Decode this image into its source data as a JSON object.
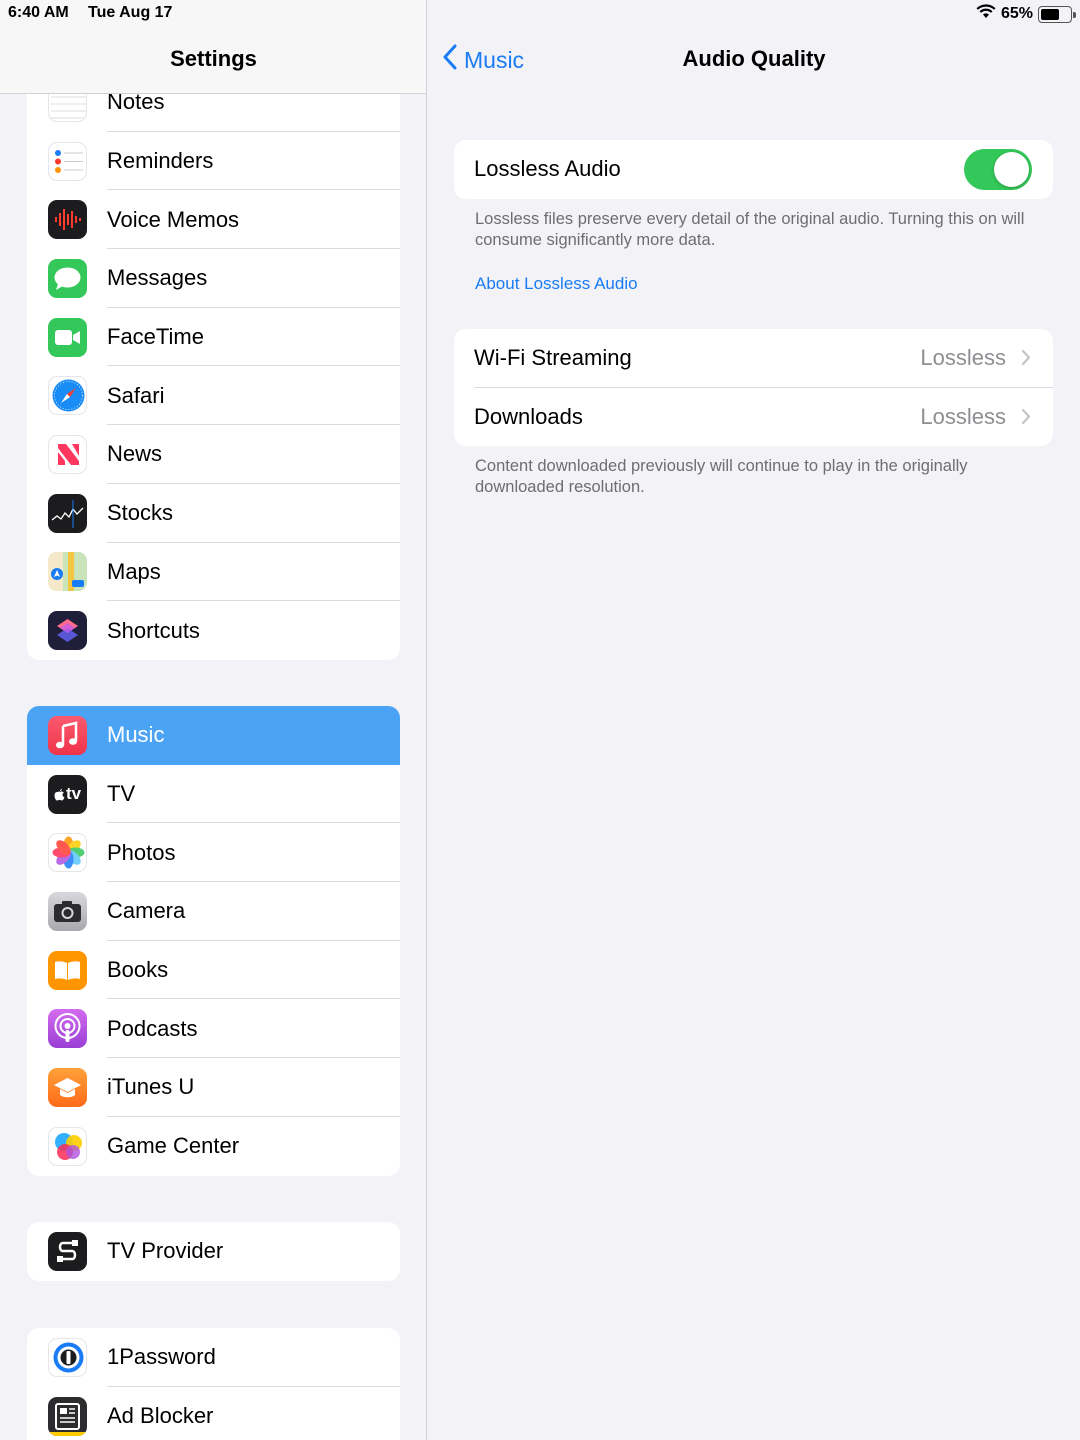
{
  "status_bar": {
    "time": "6:40 AM",
    "date": "Tue Aug 17",
    "battery_text": "65%",
    "battery_level": 0.65
  },
  "left": {
    "title": "Settings",
    "groups": [
      [
        {
          "label": "Notes",
          "icon": "notes-icon"
        },
        {
          "label": "Reminders",
          "icon": "reminders-icon"
        },
        {
          "label": "Voice Memos",
          "icon": "voice-memos-icon"
        },
        {
          "label": "Messages",
          "icon": "messages-icon"
        },
        {
          "label": "FaceTime",
          "icon": "facetime-icon"
        },
        {
          "label": "Safari",
          "icon": "safari-icon"
        },
        {
          "label": "News",
          "icon": "news-icon"
        },
        {
          "label": "Stocks",
          "icon": "stocks-icon"
        },
        {
          "label": "Maps",
          "icon": "maps-icon"
        },
        {
          "label": "Shortcuts",
          "icon": "shortcuts-icon"
        }
      ],
      [
        {
          "label": "Music",
          "icon": "music-icon",
          "selected": true
        },
        {
          "label": "TV",
          "icon": "tv-icon"
        },
        {
          "label": "Photos",
          "icon": "photos-icon"
        },
        {
          "label": "Camera",
          "icon": "camera-icon"
        },
        {
          "label": "Books",
          "icon": "books-icon"
        },
        {
          "label": "Podcasts",
          "icon": "podcasts-icon"
        },
        {
          "label": "iTunes U",
          "icon": "itunes-u-icon"
        },
        {
          "label": "Game Center",
          "icon": "game-center-icon"
        }
      ],
      [
        {
          "label": "TV Provider",
          "icon": "tv-provider-icon"
        }
      ],
      [
        {
          "label": "1Password",
          "icon": "1password-icon"
        },
        {
          "label": "Ad Blocker",
          "icon": "ad-blocker-icon"
        }
      ]
    ],
    "tv_icon_text": "tv"
  },
  "right": {
    "back_label": "Music",
    "title": "Audio Quality",
    "lossless": {
      "label": "Lossless Audio",
      "enabled": true
    },
    "lossless_footnote": "Lossless files preserve every detail of the original audio. Turning this on will consume significantly more data.",
    "about_link": "About Lossless Audio",
    "rows": [
      {
        "label": "Wi-Fi Streaming",
        "value": "Lossless"
      },
      {
        "label": "Downloads",
        "value": "Lossless"
      }
    ],
    "downloads_footnote": "Content downloaded previously will continue to play in the originally downloaded resolution."
  },
  "colors": {
    "accent": "#1a7cf5",
    "toggle_on": "#34c759",
    "selected_row": "#4ba3f6"
  }
}
